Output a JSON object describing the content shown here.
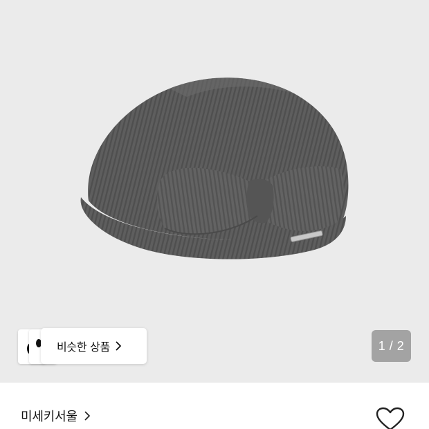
{
  "gallery": {
    "product_image_alt": "gray ribbed beret with bow",
    "similar_products_label": "비슷한 상품",
    "page_indicator": "1 / 2",
    "colors": {
      "background": "#ebebeb",
      "hat": "#5c5c5c",
      "indicator": "#a3a3a3"
    }
  },
  "product": {
    "brand_name": "미세키서울"
  },
  "icons": {
    "similar_chevron": "chevron-right-icon",
    "brand_chevron": "chevron-right-icon",
    "like": "heart-outline-icon"
  }
}
